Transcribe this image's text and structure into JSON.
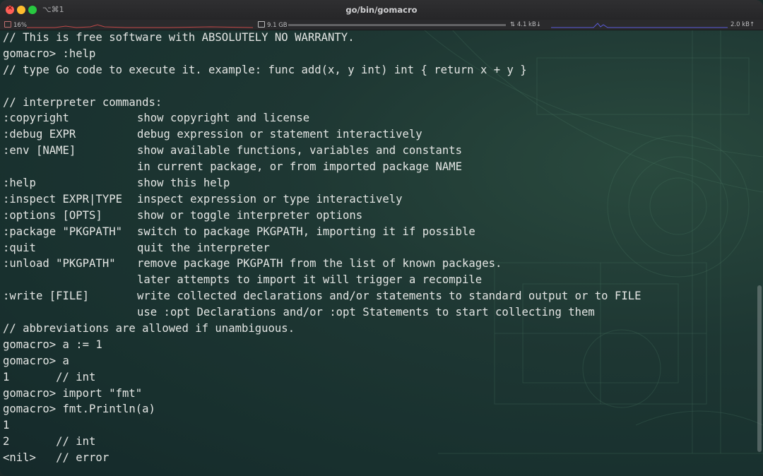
{
  "window": {
    "title": "go/bin/gomacro",
    "shortcut": "⌥⌘1"
  },
  "status": {
    "cpu": "16%",
    "memory": "9.1 GB",
    "net_down": "4.1 kB↓",
    "net_up": "2.0 kB↑"
  },
  "colors": {
    "text": "#e4e6e4",
    "background": "#1b2b2a",
    "cpu_graph": "#c04848",
    "net_graph": "#5a5ad8"
  },
  "terminal": {
    "lines": [
      "// This is free software with ABSOLUTELY NO WARRANTY.",
      "gomacro> :help",
      "// type Go code to execute it. example: func add(x, y int) int { return x + y }",
      "",
      "// interpreter commands:"
    ],
    "commands": [
      {
        "cmd": ":copyright",
        "desc": "show copyright and license"
      },
      {
        "cmd": ":debug EXPR",
        "desc": "debug expression or statement interactively"
      },
      {
        "cmd": ":env [NAME]",
        "desc": "show available functions, variables and constants"
      },
      {
        "cmd": "",
        "desc": "in current package, or from imported package NAME"
      },
      {
        "cmd": ":help",
        "desc": "show this help"
      },
      {
        "cmd": ":inspect EXPR|TYPE",
        "desc": "inspect expression or type interactively"
      },
      {
        "cmd": ":options [OPTS]",
        "desc": "show or toggle interpreter options"
      },
      {
        "cmd": ":package \"PKGPATH\"",
        "desc": "switch to package PKGPATH, importing it if possible"
      },
      {
        "cmd": ":quit",
        "desc": "quit the interpreter"
      },
      {
        "cmd": ":unload \"PKGPATH\"",
        "desc": "remove package PKGPATH from the list of known packages."
      },
      {
        "cmd": "",
        "desc": "later attempts to import it will trigger a recompile"
      },
      {
        "cmd": ":write [FILE]",
        "desc": "write collected declarations and/or statements to standard output or to FILE"
      },
      {
        "cmd": "",
        "desc": "use :opt Declarations and/or :opt Statements to start collecting them"
      }
    ],
    "tail": [
      "// abbreviations are allowed if unambiguous.",
      "gomacro> a := 1",
      "gomacro> a",
      "1       // int",
      "gomacro> import \"fmt\"",
      "gomacro> fmt.Println(a)",
      "1",
      "2       // int",
      "<nil>   // error"
    ]
  }
}
